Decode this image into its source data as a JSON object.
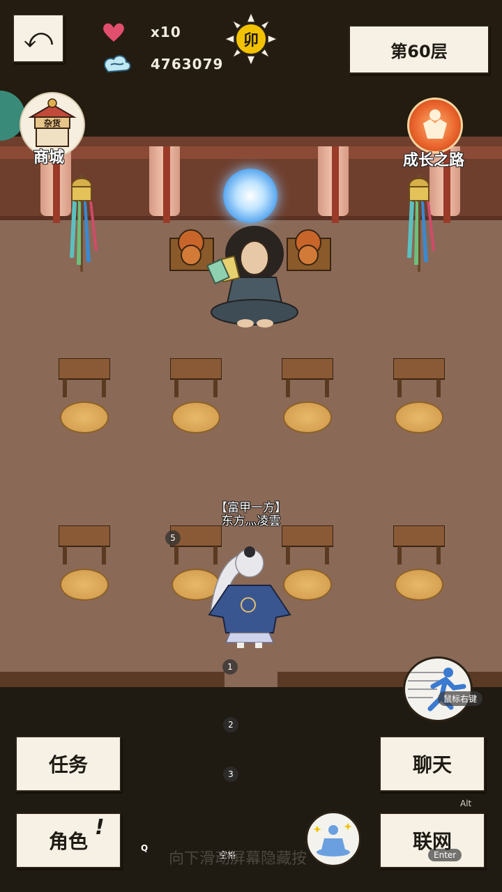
{
  "top": {
    "back_label": "⤺",
    "lives_value": "x10",
    "currency_value": "4763079",
    "time_symbol": "卯",
    "floor_label": "第60层"
  },
  "shortcuts": {
    "shop_label": "商城",
    "shop_sign": "杂货",
    "growth_label": "成长之路"
  },
  "player": {
    "title": "【富甲一方】",
    "name": "东方灬凌雲"
  },
  "badges": [
    "5",
    "1",
    "2",
    "3"
  ],
  "buttons": {
    "quest": "任务",
    "character": "角色",
    "chat": "聊天",
    "network": "联网",
    "exclaim": "!"
  },
  "hints": {
    "run": "鼠标右键",
    "alt": "Alt",
    "enter": "Enter",
    "space": "空格",
    "q": "Q"
  },
  "footer_tip": "向下滑动屏幕隐藏按",
  "colors": {
    "background": "#1f1a12",
    "floor": "#8a6957",
    "paper": "#f6f1e4",
    "heart": "#e0506e",
    "sun": "#f2c200"
  }
}
